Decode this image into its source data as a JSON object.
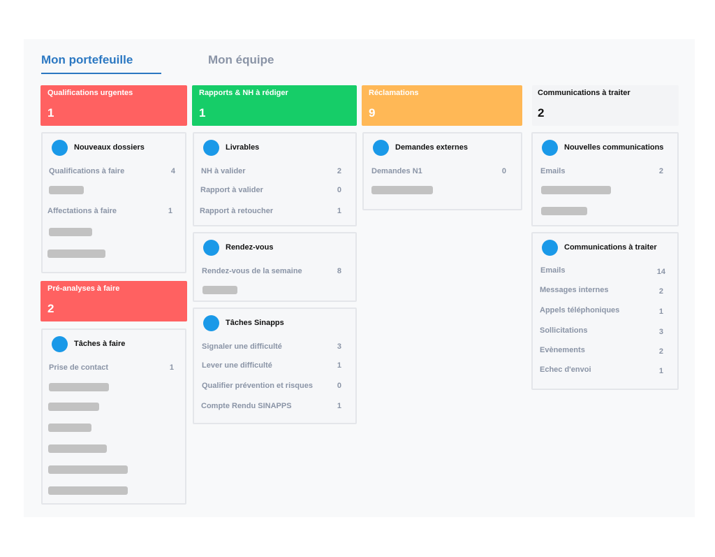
{
  "tabs": [
    {
      "label": "Mon portefeuille",
      "active": true
    },
    {
      "label": "Mon équipe",
      "active": false
    }
  ],
  "stats": [
    {
      "title": "Qualifications urgentes",
      "count": "1",
      "color": "#ff6161"
    },
    {
      "title": "Rapports & NH à rédiger",
      "count": "1",
      "color": "#16cd68"
    },
    {
      "title": "Réclamations",
      "count": "9",
      "color": "#ffb856"
    },
    {
      "title": "Communications à traiter",
      "count": "2",
      "color": "#f3f4f6"
    },
    {
      "title": "Pré-analyses à faire",
      "count": "2",
      "color": "#ff6161"
    }
  ],
  "cards": {
    "nouveaux_dossiers": {
      "title": "Nouveaux dossiers",
      "icon": "circle-icon",
      "rows": [
        {
          "label": "Qualifications à faire",
          "count": "4"
        },
        {
          "label": "Affectations à faire",
          "count": "1"
        }
      ]
    },
    "taches_a_faire": {
      "title": "Tâches à faire",
      "icon": "circle-icon",
      "rows": [
        {
          "label": "Prise de contact",
          "count": "1"
        }
      ]
    },
    "livrables": {
      "title": "Livrables",
      "icon": "circle-icon",
      "rows": [
        {
          "label": "NH à valider",
          "count": "2"
        },
        {
          "label": "Rapport  à valider",
          "count": "0"
        },
        {
          "label": "Rapport  à retoucher",
          "count": "1"
        }
      ]
    },
    "rendez_vous": {
      "title": "Rendez-vous",
      "icon": "circle-icon",
      "rows": [
        {
          "label": "Rendez-vous de la semaine",
          "count": "8"
        }
      ]
    },
    "taches_sinapps": {
      "title": "Tâches Sinapps",
      "icon": "circle-icon",
      "rows": [
        {
          "label": "Signaler une difficulté",
          "count": "3"
        },
        {
          "label": "Lever une difficulté",
          "count": "1"
        },
        {
          "label": "Qualifier prévention et risques",
          "count": "0"
        },
        {
          "label": "Compte Rendu SINAPPS",
          "count": "1"
        }
      ]
    },
    "demandes_externes": {
      "title": "Demandes externes",
      "icon": "circle-icon",
      "rows": [
        {
          "label": "Demandes N1",
          "count": "0"
        }
      ]
    },
    "nouvelles_communications": {
      "title": "Nouvelles communications",
      "icon": "circle-icon",
      "rows": [
        {
          "label": "Emails",
          "count": "2"
        }
      ]
    },
    "communications_a_traiter": {
      "title": "Communications à traiter",
      "icon": "circle-icon",
      "rows": [
        {
          "label": "Emails",
          "count": "14"
        },
        {
          "label": "Messages internes",
          "count": "2"
        },
        {
          "label": "Appels téléphoniques",
          "count": "1"
        },
        {
          "label": "Sollicitations",
          "count": "3"
        },
        {
          "label": "Evènements",
          "count": "2"
        },
        {
          "label": "Echec d'envoi",
          "count": "1"
        }
      ]
    }
  },
  "colors": {
    "accent": "#2b78c2",
    "dot": "#1a99e8",
    "urgent": "#ff6161",
    "success": "#16cd68",
    "warning": "#ffb856"
  }
}
